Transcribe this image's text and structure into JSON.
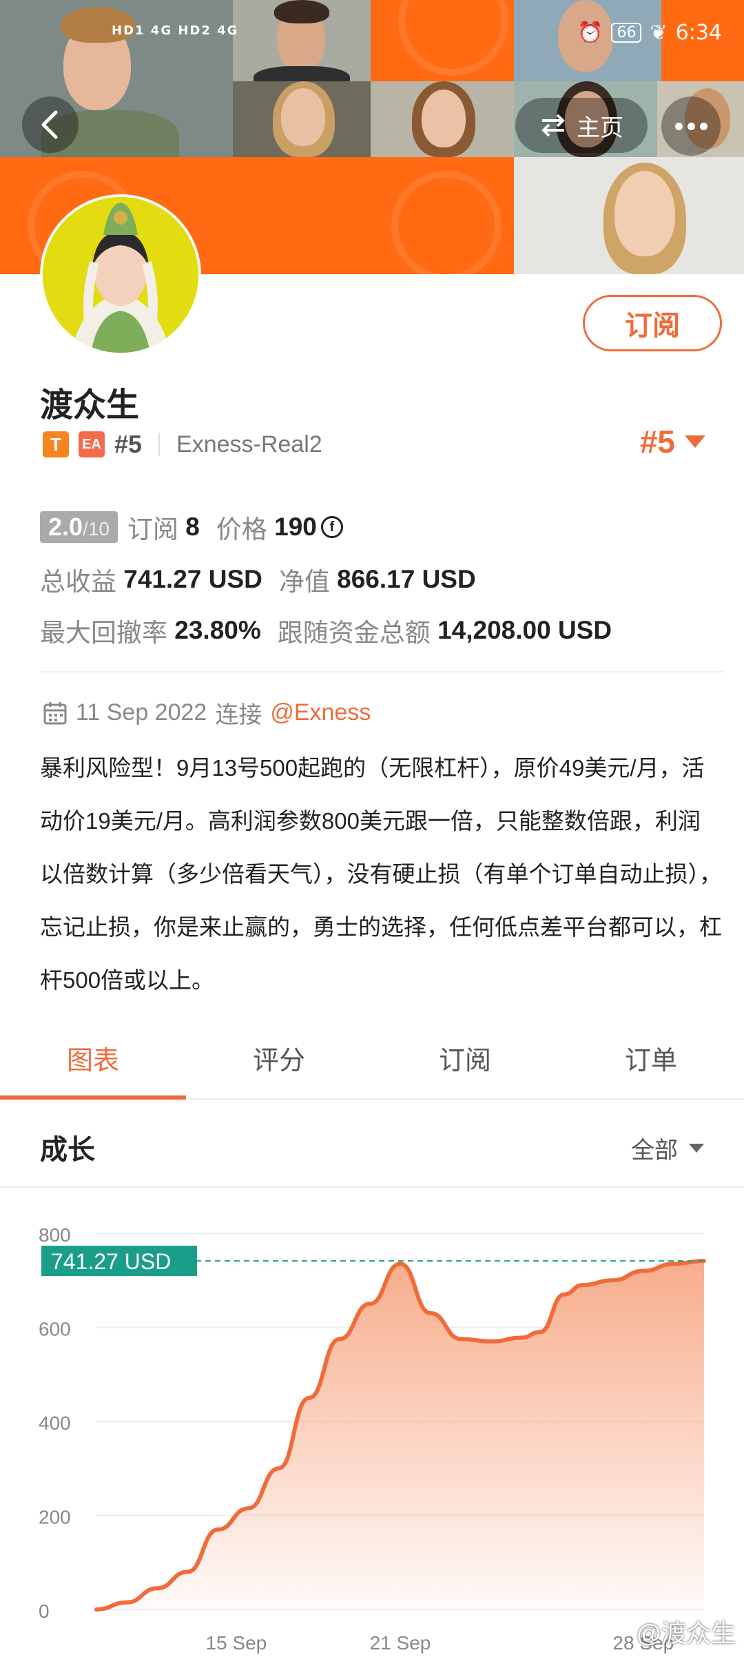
{
  "status_bar": {
    "signal_text": "HD1 4G HD2 4G",
    "battery": "66",
    "time": "6:34"
  },
  "header": {
    "home_label": "主页",
    "icons": [
      "back-arrow-icon",
      "swap-icon",
      "more-icon"
    ]
  },
  "profile": {
    "name": "渡众生",
    "tag_t": "T",
    "tag_ea": "EA",
    "rank_small": "#5",
    "account": "Exness-Real2",
    "rank_big": "#5",
    "subscribe_label": "订阅"
  },
  "stats": {
    "score": "2.0",
    "score_max": "/10",
    "subscriptions_label": "订阅",
    "subscriptions_value": "8",
    "price_label": "价格",
    "price_value": "190",
    "total_profit_label": "总收益",
    "total_profit_value": "741.27 USD",
    "net_value_label": "净值",
    "net_value_value": "866.17 USD",
    "max_drawdown_label": "最大回撤率",
    "max_drawdown_value": "23.80%",
    "follow_funds_label": "跟随资金总额",
    "follow_funds_value": "14,208.00 USD"
  },
  "connection": {
    "date": "11 Sep 2022",
    "connect_label": "连接",
    "broker": "@Exness"
  },
  "description": "暴利风险型！9月13号500起跑的（无限杠杆），原价49美元/月，活动价19美元/月。高利润参数800美元跟一倍，只能整数倍跟，利润以倍数计算（多少倍看天气），没有硬止损（有单个订单自动止损），忘记止损，你是来止赢的，勇士的选择，任何低点差平台都可以，杠杆500倍或以上。",
  "tabs": [
    "图表",
    "评分",
    "订阅",
    "订单"
  ],
  "section": {
    "title": "成长",
    "range": "全部"
  },
  "chart_data": {
    "type": "area",
    "title": "成长",
    "current_label": "741.27 USD",
    "current_value": 741.27,
    "ylim": [
      0,
      800
    ],
    "yticks": [
      0,
      200,
      400,
      600,
      800
    ],
    "xticks": [
      "15 Sep",
      "21 Sep",
      "28 Sep"
    ],
    "x": [
      0,
      0.05,
      0.1,
      0.15,
      0.2,
      0.25,
      0.3,
      0.35,
      0.4,
      0.45,
      0.5,
      0.55,
      0.6,
      0.65,
      0.7,
      0.73,
      0.77,
      0.8,
      0.85,
      0.9,
      0.95,
      1.0
    ],
    "values": [
      0,
      15,
      45,
      80,
      170,
      215,
      300,
      450,
      575,
      650,
      735,
      630,
      575,
      570,
      578,
      590,
      670,
      690,
      700,
      720,
      735,
      741.27
    ],
    "line_color": "#ef6c3a",
    "fill_color": "#f7a47f",
    "reference_color": "#1a9e8a"
  },
  "watermark": "@渡众生"
}
